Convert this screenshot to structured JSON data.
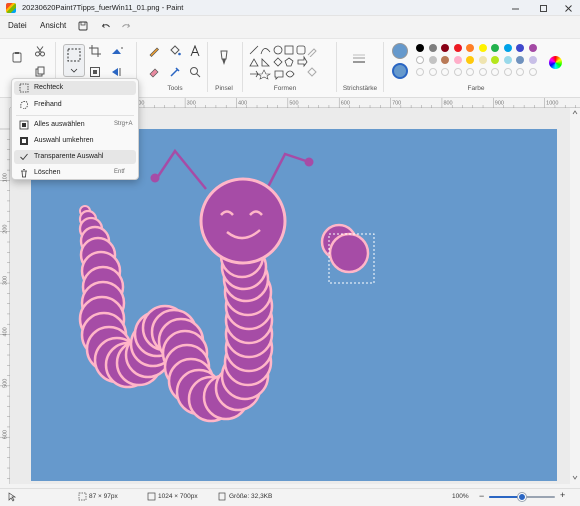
{
  "window": {
    "title": "20230620Paint7Tipps_fuerWin11_01.png - Paint"
  },
  "menu": {
    "file": "Datei",
    "view": "Ansicht"
  },
  "ribbon": {
    "groups": {
      "tools": "Tools",
      "brushes": "Pinsel",
      "shapes": "Formen",
      "stroke": "Strichstärke",
      "color": "Farbe"
    },
    "palette_row1": [
      "#000000",
      "#7f7f7f",
      "#880015",
      "#ed1c24",
      "#ff7f27",
      "#fff200",
      "#22b14c",
      "#00a2e8",
      "#3f48cc",
      "#a349a4"
    ],
    "palette_row2": [
      "#ffffff",
      "#c3c3c3",
      "#b97a57",
      "#ffaec9",
      "#ffc90e",
      "#efe4b0",
      "#b5e61d",
      "#99d9ea",
      "#7092be",
      "#c8bfe7"
    ],
    "primary_color": "#6699cc",
    "secondary_color": "#6699cc"
  },
  "ruler_top": [
    "100",
    "200",
    "300",
    "400",
    "500",
    "600",
    "700",
    "800",
    "900",
    "1000"
  ],
  "ruler_left": [
    "100",
    "200",
    "300",
    "400",
    "500",
    "600"
  ],
  "selection_menu": {
    "rectangle": "Rechteck",
    "freeform": "Freihand",
    "select_all": "Alles auswählen",
    "select_all_shortcut": "Strg+A",
    "invert": "Auswahl umkehren",
    "transparent": "Transparente Auswahl",
    "delete": "Löschen",
    "delete_shortcut": "Entf"
  },
  "status": {
    "selection_size": "87 × 97px",
    "canvas_size": "1024 × 700px",
    "file_size": "Größe: 32,3KB",
    "zoom": "100%",
    "zoom_fraction": 0.5
  },
  "drawing": {
    "background": "#6699cc",
    "body_fill": "#a64ca6",
    "outline": "#ffb6c8",
    "antenna": "#a64ca6"
  }
}
